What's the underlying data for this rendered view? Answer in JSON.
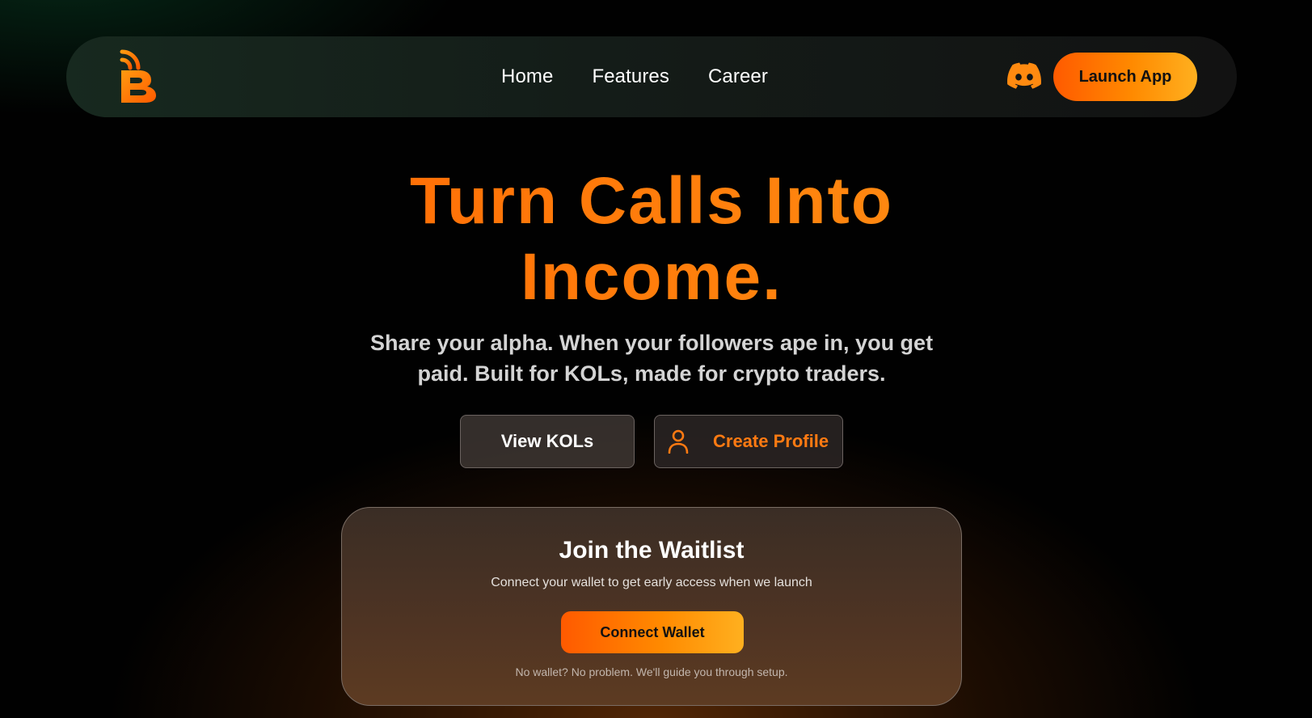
{
  "nav": {
    "links": [
      "Home",
      "Features",
      "Career"
    ],
    "launch_label": "Launch App",
    "discord_icon": "discord-icon",
    "logo_icon": "b-signal-logo"
  },
  "hero": {
    "title_line1": "Turn Calls Into",
    "title_line2": "Income.",
    "subtitle_line1": "Share your alpha. When your followers ape in, you get",
    "subtitle_line2": "paid. Built for KOLs, made for crypto traders.",
    "view_kols_label": "View KOLs",
    "create_profile_label": "Create Profile",
    "create_profile_icon": "user-icon"
  },
  "waitlist": {
    "title": "Join the Waitlist",
    "description": "Connect your wallet to get early access when we launch",
    "connect_label": "Connect Wallet",
    "note": "No wallet? No problem. We'll guide you through setup."
  },
  "colors": {
    "accent_orange": "#ff6a00",
    "accent_gold": "#ffb01f",
    "background": "#010101"
  }
}
